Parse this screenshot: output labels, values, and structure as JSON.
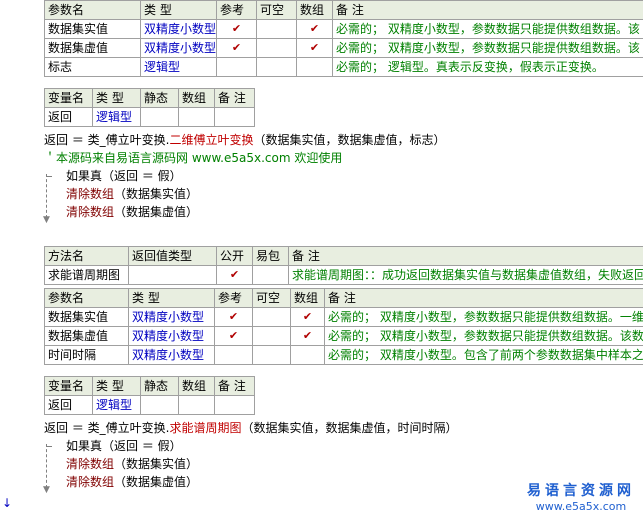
{
  "block1": {
    "param_header": [
      "参数名",
      "类 型",
      "参考",
      "可空",
      "数组",
      "备 注"
    ],
    "params": [
      {
        "name": "数据集实值",
        "type": "双精度小数型",
        "ref": "✔",
        "nullable": "",
        "array": "✔",
        "note": "必需的；  双精度小数型，参数数据只能提供数组数据。该"
      },
      {
        "name": "数据集虚值",
        "type": "双精度小数型",
        "ref": "✔",
        "nullable": "",
        "array": "✔",
        "note": "必需的；  双精度小数型，参数数据只能提供数组数据。该"
      },
      {
        "name": "标志",
        "type": "逻辑型",
        "ref": "",
        "nullable": "",
        "array": "",
        "note": "必需的；  逻辑型。真表示反变换，假表示正变换。"
      }
    ],
    "var_header": [
      "变量名",
      "类 型",
      "静态",
      "数组",
      "备 注"
    ],
    "vars": [
      {
        "name": "返回",
        "type": "逻辑型",
        "static": "",
        "array": "",
        "note": ""
      }
    ],
    "code": {
      "assign": "返回 ＝ 类_傅立叶变换.",
      "func": "二维傅立叶变换",
      "args": "（数据集实值，数据集虚值，标志）",
      "comment": "＇本源码来自易语言源码网 www.e5a5x.com  欢迎使用",
      "if": "如果真（返回 ＝ 假）",
      "clear1_fn": "清除数组",
      "clear1_arg": "（数据集实值）",
      "clear2_fn": "清除数组",
      "clear2_arg": "（数据集虚值）"
    }
  },
  "block2": {
    "method_header": [
      "方法名",
      "返回值类型",
      "公开",
      "易包",
      "备 注"
    ],
    "method": {
      "name": "求能谱周期图",
      "return_type": "",
      "public": "✔",
      "pkg": "",
      "note": "求能谱周期图：：成功返回数据集实值与数据集虚值数组，失败返回空"
    },
    "param_header": [
      "参数名",
      "类 型",
      "参考",
      "可空",
      "数组",
      "备 注"
    ],
    "params": [
      {
        "name": "数据集实值",
        "type": "双精度小数型",
        "ref": "✔",
        "nullable": "",
        "array": "✔",
        "note": "必需的；  双精度小数型，参数数据只能提供数组数据。一维"
      },
      {
        "name": "数据集虚值",
        "type": "双精度小数型",
        "ref": "✔",
        "nullable": "",
        "array": "✔",
        "note": "必需的；  双精度小数型，参数数据只能提供数组数据。该数"
      },
      {
        "name": "时间时隔",
        "type": "双精度小数型",
        "ref": "",
        "nullable": "",
        "array": "",
        "note": "必需的；  双精度小数型。包含了前两个参数数据集中样本之"
      }
    ],
    "var_header": [
      "变量名",
      "类 型",
      "静态",
      "数组",
      "备 注"
    ],
    "vars": [
      {
        "name": "返回",
        "type": "逻辑型",
        "static": "",
        "array": "",
        "note": ""
      }
    ],
    "code": {
      "assign": "返回 ＝ 类_傅立叶变换.",
      "func": "求能谱周期图",
      "args": "（数据集实值，数据集虚值，时间时隔）",
      "if": "如果真（返回 ＝ 假）",
      "clear1_fn": "清除数组",
      "clear1_arg": "（数据集实值）",
      "clear2_fn": "清除数组",
      "clear2_arg": "（数据集虚值）"
    }
  },
  "watermark": {
    "cn": "易语言资源网",
    "en": "www.e5a5x.com"
  },
  "edge_arrow": "↓"
}
